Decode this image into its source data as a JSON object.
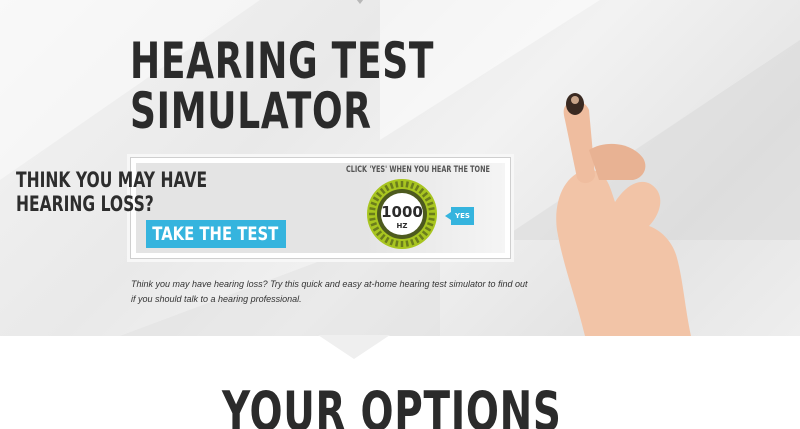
{
  "hero": {
    "title_line1": "HEARING TEST",
    "title_line2": "SIMULATOR",
    "card": {
      "headline_line1": "THINK YOU MAY HAVE",
      "headline_line2": "HEARING LOSS?",
      "cta_label": "TAKE THE TEST",
      "tone_caption": "CLICK 'YES' WHEN YOU HEAR THE TONE",
      "frequency_value": "1000",
      "frequency_unit": "HZ",
      "yes_label": "YES"
    },
    "description": "Think you may have hearing loss? Try this quick and easy at-home hearing test simulator to find out if you should talk to a hearing professional."
  },
  "options": {
    "title": "YOUR OPTIONS"
  },
  "colors": {
    "accent": "#35b4de",
    "dial_ring": "#a8c520",
    "dial_dark": "#4d5a1e",
    "text_dark": "#2b2b2b"
  },
  "icons": {
    "dial": "frequency-dial-icon",
    "hand": "hand-holding-hearing-aid-icon"
  }
}
